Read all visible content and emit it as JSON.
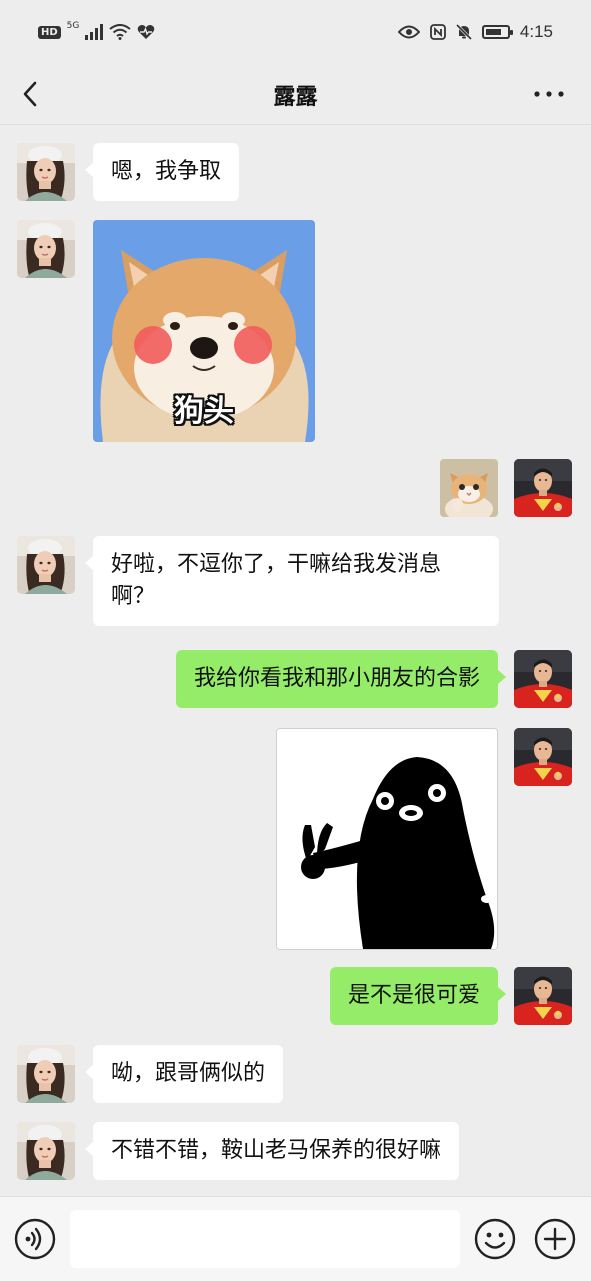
{
  "status_bar": {
    "hd_label": "HD",
    "network": "5G",
    "time": "4:15",
    "battery_level": 0.75,
    "icons": [
      "signal-icon",
      "wifi-icon",
      "heart-rate-icon",
      "eye-icon",
      "nfc-icon",
      "mute-icon",
      "battery-icon"
    ]
  },
  "header": {
    "title": "露露",
    "back_icon": "back-icon",
    "more_icon": "more-icon"
  },
  "messages": [
    {
      "from": "contact",
      "type": "text",
      "text": "嗯，我争取"
    },
    {
      "from": "contact",
      "type": "sticker",
      "sticker": "shiba-dog-sticker",
      "caption": "狗头"
    },
    {
      "from": "me",
      "type": "sticker",
      "sticker": "cat-sticker"
    },
    {
      "from": "contact",
      "type": "text",
      "text": "好啦，不逗你了，干嘛给我发消息啊？"
    },
    {
      "from": "me",
      "type": "text",
      "text": "我给你看我和那小朋友的合影"
    },
    {
      "from": "me",
      "type": "sticker",
      "sticker": "penguin-peace-sticker"
    },
    {
      "from": "me",
      "type": "text",
      "text": "是不是很可爱"
    },
    {
      "from": "contact",
      "type": "text",
      "text": "呦，跟哥俩似的"
    },
    {
      "from": "contact",
      "type": "text",
      "text": "不错不错，鞍山老马保养的很好嘛"
    }
  ],
  "input_bar": {
    "value": "",
    "voice_icon": "voice-icon",
    "emoji_icon": "emoji-icon",
    "plus_icon": "plus-icon"
  },
  "colors": {
    "background": "#ededed",
    "my_bubble": "#95ec69",
    "their_bubble": "#ffffff",
    "sticker_blue": "#6a9fe8"
  }
}
